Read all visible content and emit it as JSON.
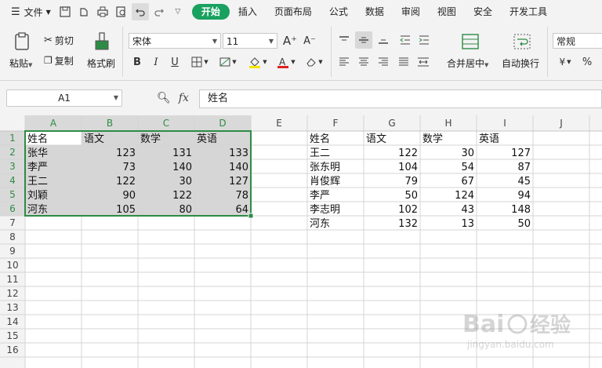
{
  "menubar": {
    "file_label": "文件",
    "tabs": [
      {
        "label": "开始",
        "active": true
      },
      {
        "label": "插入",
        "active": false
      },
      {
        "label": "页面布局",
        "active": false
      },
      {
        "label": "公式",
        "active": false
      },
      {
        "label": "数据",
        "active": false
      },
      {
        "label": "审阅",
        "active": false
      },
      {
        "label": "视图",
        "active": false
      },
      {
        "label": "安全",
        "active": false
      },
      {
        "label": "开发工具",
        "active": false
      }
    ]
  },
  "ribbon": {
    "paste_label": "粘贴",
    "cut_label": "剪切",
    "copy_label": "复制",
    "format_painter_label": "格式刷",
    "font_name": "宋体",
    "font_size": "11",
    "merge_center_label": "合并居中",
    "wrap_text_label": "自动换行",
    "number_format": "常规"
  },
  "formula": {
    "name_box": "A1",
    "fx_label": "fx",
    "content": "姓名"
  },
  "colors": {
    "accent": "#19a15f",
    "selection_border": "#2e8b45",
    "selection_fill": "#d6d6d6",
    "header_bg": "#f3f3f3"
  },
  "sheet": {
    "columns": [
      "A",
      "B",
      "C",
      "D",
      "E",
      "F",
      "G",
      "H",
      "I",
      "J"
    ],
    "rows": [
      "1",
      "2",
      "3",
      "4",
      "5",
      "6",
      "7",
      "8",
      "9",
      "10",
      "11",
      "12",
      "13",
      "14",
      "15",
      "16"
    ],
    "cells": [
      {
        "ref": "A1",
        "text": "姓名",
        "align": "left"
      },
      {
        "ref": "B1",
        "text": "语文",
        "align": "left"
      },
      {
        "ref": "C1",
        "text": "数学",
        "align": "left"
      },
      {
        "ref": "D1",
        "text": "英语",
        "align": "left"
      },
      {
        "ref": "A2",
        "text": "张华",
        "align": "left"
      },
      {
        "ref": "B2",
        "text": "123",
        "align": "right"
      },
      {
        "ref": "C2",
        "text": "131",
        "align": "right"
      },
      {
        "ref": "D2",
        "text": "133",
        "align": "right"
      },
      {
        "ref": "A3",
        "text": "李严",
        "align": "left"
      },
      {
        "ref": "B3",
        "text": "73",
        "align": "right"
      },
      {
        "ref": "C3",
        "text": "140",
        "align": "right"
      },
      {
        "ref": "D3",
        "text": "140",
        "align": "right"
      },
      {
        "ref": "A4",
        "text": "王二",
        "align": "left"
      },
      {
        "ref": "B4",
        "text": "122",
        "align": "right"
      },
      {
        "ref": "C4",
        "text": "30",
        "align": "right"
      },
      {
        "ref": "D4",
        "text": "127",
        "align": "right"
      },
      {
        "ref": "A5",
        "text": "刘颖",
        "align": "left"
      },
      {
        "ref": "B5",
        "text": "90",
        "align": "right"
      },
      {
        "ref": "C5",
        "text": "122",
        "align": "right"
      },
      {
        "ref": "D5",
        "text": "78",
        "align": "right"
      },
      {
        "ref": "A6",
        "text": "河东",
        "align": "left"
      },
      {
        "ref": "B6",
        "text": "105",
        "align": "right"
      },
      {
        "ref": "C6",
        "text": "80",
        "align": "right"
      },
      {
        "ref": "D6",
        "text": "64",
        "align": "right"
      },
      {
        "ref": "F1",
        "text": "姓名",
        "align": "left"
      },
      {
        "ref": "G1",
        "text": "语文",
        "align": "left"
      },
      {
        "ref": "H1",
        "text": "数学",
        "align": "left"
      },
      {
        "ref": "I1",
        "text": "英语",
        "align": "left"
      },
      {
        "ref": "F2",
        "text": "王二",
        "align": "left"
      },
      {
        "ref": "G2",
        "text": "122",
        "align": "right"
      },
      {
        "ref": "H2",
        "text": "30",
        "align": "right"
      },
      {
        "ref": "I2",
        "text": "127",
        "align": "right"
      },
      {
        "ref": "F3",
        "text": "张东明",
        "align": "left"
      },
      {
        "ref": "G3",
        "text": "104",
        "align": "right"
      },
      {
        "ref": "H3",
        "text": "54",
        "align": "right"
      },
      {
        "ref": "I3",
        "text": "87",
        "align": "right"
      },
      {
        "ref": "F4",
        "text": "肖俊辉",
        "align": "left"
      },
      {
        "ref": "G4",
        "text": "79",
        "align": "right"
      },
      {
        "ref": "H4",
        "text": "67",
        "align": "right"
      },
      {
        "ref": "I4",
        "text": "45",
        "align": "right"
      },
      {
        "ref": "F5",
        "text": "李严",
        "align": "left"
      },
      {
        "ref": "G5",
        "text": "50",
        "align": "right"
      },
      {
        "ref": "H5",
        "text": "124",
        "align": "right"
      },
      {
        "ref": "I5",
        "text": "94",
        "align": "right"
      },
      {
        "ref": "F6",
        "text": "李志明",
        "align": "left"
      },
      {
        "ref": "G6",
        "text": "102",
        "align": "right"
      },
      {
        "ref": "H6",
        "text": "43",
        "align": "right"
      },
      {
        "ref": "I6",
        "text": "148",
        "align": "right"
      },
      {
        "ref": "F7",
        "text": "河东",
        "align": "left"
      },
      {
        "ref": "G7",
        "text": "132",
        "align": "right"
      },
      {
        "ref": "H7",
        "text": "13",
        "align": "right"
      },
      {
        "ref": "I7",
        "text": "50",
        "align": "right"
      }
    ],
    "selection": {
      "from": "A1",
      "to": "D6"
    }
  },
  "watermark": {
    "brand": "Bai",
    "brand2": "经验",
    "url": "jingyan.baidu.com"
  }
}
